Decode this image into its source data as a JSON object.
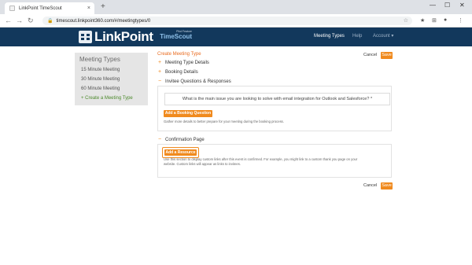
{
  "browser": {
    "tab_title": "LinkPoint TimeScout",
    "tab_close": "×",
    "new_tab": "+",
    "url": "timescout.linkpoint360.com/#/meetingtypes/0",
    "lock_icon": "lock-icon",
    "back": "←",
    "forward": "→",
    "reload": "↻",
    "star": "☆",
    "minimize": "—",
    "maximize": "☐",
    "close": "✕",
    "ext_icons": [
      "★",
      "⊞",
      "●",
      "⋮"
    ]
  },
  "app": {
    "logo_main": "LinkPoint",
    "logo_pilot": "Pilot Feature",
    "logo_product": "TimeScout",
    "nav": [
      {
        "label": "Meeting Types",
        "active": true
      },
      {
        "label": "Help",
        "active": false
      },
      {
        "label": "Account ▾",
        "active": false
      }
    ],
    "header_color": "#12385c",
    "accent_color": "#f08a1e"
  },
  "sidebar": {
    "title": "Meeting Types",
    "items": [
      {
        "label": "15 Minute Meeting"
      },
      {
        "label": "30 Minute Meeting"
      },
      {
        "label": "60 Minute Meeting"
      },
      {
        "label": "+ Create a Meeting Type"
      }
    ]
  },
  "main": {
    "page_title": "Create Meeting Type",
    "cancel_label": "Cancel",
    "save_label": "Save",
    "sections": {
      "meeting_type_details": {
        "symbol": "+",
        "label": "Meeting Type Details"
      },
      "booking_details": {
        "symbol": "+",
        "label": "Booking Details"
      },
      "invitee_questions": {
        "symbol": "−",
        "label": "Invitee Questions & Responses"
      },
      "confirmation_page": {
        "symbol": "−",
        "label": "Confirmation Page"
      }
    },
    "question_text": "What is the main issue you are looking to solve with email integration for Outlook and Salesforce? *",
    "add_booking_question_label": "Add a Booking Question",
    "booking_question_help": "Gather more details to better prepare for your meeting during the booking process.",
    "add_resource_label": "Add a Resource",
    "resource_help_line1": "Use this section to display custom links after this event is confirmed. For example, you might link to a custom thank you page on your",
    "resource_help_line2": "website. Custom links will appear as links to invitees."
  }
}
